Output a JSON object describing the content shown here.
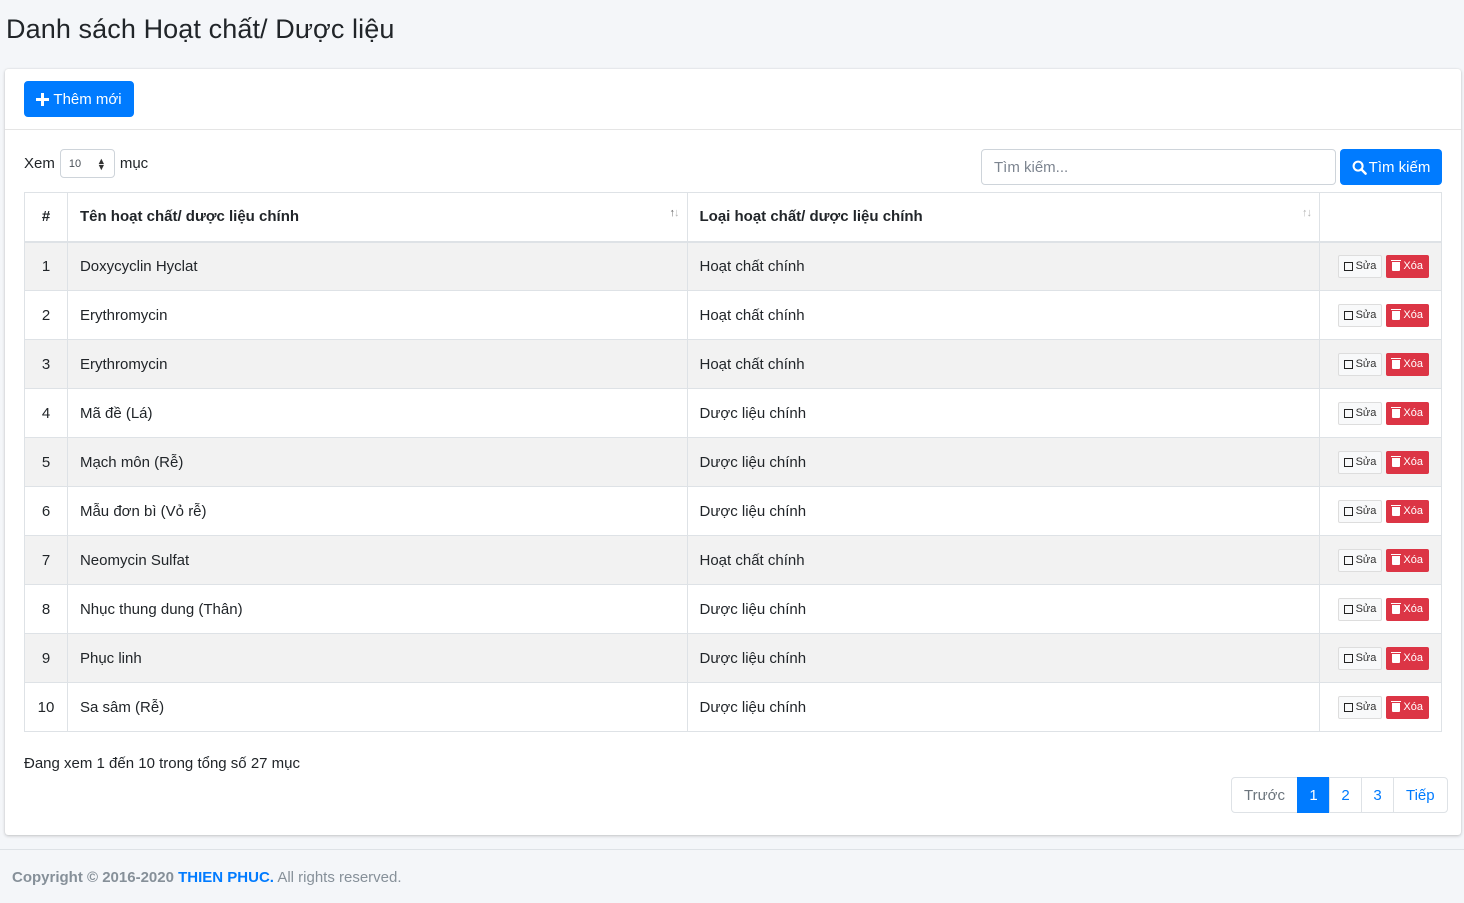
{
  "page": {
    "title": "Danh sách Hoạt chất/ Dược liệu"
  },
  "toolbar": {
    "add_label": "Thêm mới"
  },
  "length": {
    "prefix": "Xem",
    "value": "10",
    "suffix": "mục"
  },
  "search": {
    "placeholder": "Tìm kiếm...",
    "button_label": "Tìm kiếm"
  },
  "table": {
    "headers": {
      "num": "#",
      "name": "Tên hoạt chất/ dược liệu chính",
      "type": "Loại hoạt chất/ dược liệu chính"
    },
    "edit_label": "Sửa",
    "delete_label": "Xóa",
    "rows": [
      {
        "num": "1",
        "name": "Doxycyclin Hyclat",
        "type": "Hoạt chất chính"
      },
      {
        "num": "2",
        "name": "Erythromycin",
        "type": "Hoạt chất chính"
      },
      {
        "num": "3",
        "name": "Erythromycin",
        "type": "Hoạt chất chính"
      },
      {
        "num": "4",
        "name": "Mã đề (Lá)",
        "type": "Dược liệu chính"
      },
      {
        "num": "5",
        "name": "Mạch môn (Rễ)",
        "type": "Dược liệu chính"
      },
      {
        "num": "6",
        "name": "Mẫu đơn bì (Vỏ rễ)",
        "type": "Dược liệu chính"
      },
      {
        "num": "7",
        "name": "Neomycin Sulfat",
        "type": "Hoạt chất chính"
      },
      {
        "num": "8",
        "name": "Nhục thung dung (Thân)",
        "type": "Dược liệu chính"
      },
      {
        "num": "9",
        "name": "Phục linh",
        "type": "Dược liệu chính"
      },
      {
        "num": "10",
        "name": "Sa sâm (Rễ)",
        "type": "Dược liệu chính"
      }
    ]
  },
  "info": "Đang xem 1 đến 10 trong tổng số 27 mục",
  "pagination": {
    "prev": "Trước",
    "pages": [
      "1",
      "2",
      "3"
    ],
    "active": "1",
    "next": "Tiếp"
  },
  "footer": {
    "copyright": "Copyright © 2016-2020",
    "brand": "THIEN PHUC.",
    "rights": "All rights reserved."
  },
  "colors": {
    "primary": "#007bff",
    "danger": "#dc3545",
    "background": "#f4f6f9"
  }
}
